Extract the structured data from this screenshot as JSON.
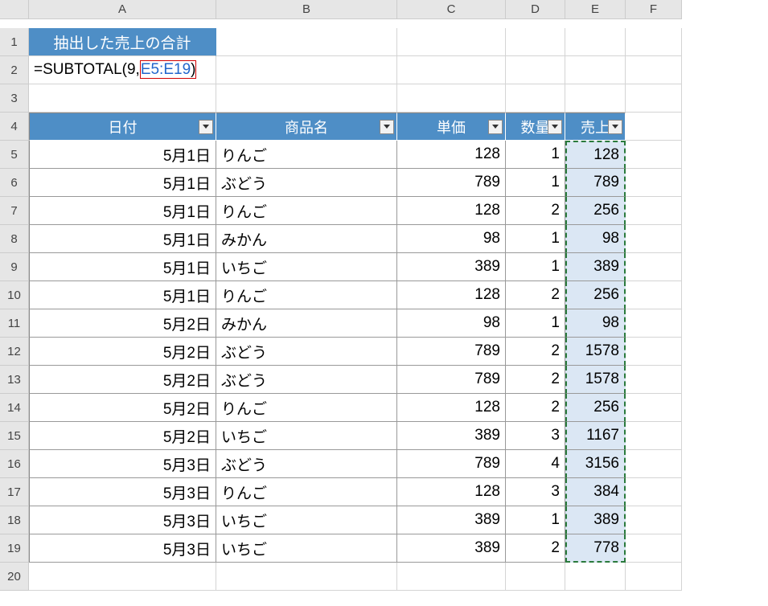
{
  "columns": [
    "A",
    "B",
    "C",
    "D",
    "E",
    "F"
  ],
  "row_numbers": [
    1,
    2,
    3,
    4,
    5,
    6,
    7,
    8,
    9,
    10,
    11,
    12,
    13,
    14,
    15,
    16,
    17,
    18,
    19,
    20
  ],
  "title_cell": "抽出した売上の合計",
  "formula": {
    "prefix": "=SUBTOTAL(9,",
    "ref": "E5:E19",
    "suffix": ")"
  },
  "headers": {
    "date": "日付",
    "product": "商品名",
    "unit_price": "単価",
    "qty": "数量",
    "sales": "売上"
  },
  "rows": [
    {
      "date": "5月1日",
      "product": "りんご",
      "unit_price": 128,
      "qty": 1,
      "sales": 128
    },
    {
      "date": "5月1日",
      "product": "ぶどう",
      "unit_price": 789,
      "qty": 1,
      "sales": 789
    },
    {
      "date": "5月1日",
      "product": "りんご",
      "unit_price": 128,
      "qty": 2,
      "sales": 256
    },
    {
      "date": "5月1日",
      "product": "みかん",
      "unit_price": 98,
      "qty": 1,
      "sales": 98
    },
    {
      "date": "5月1日",
      "product": "いちご",
      "unit_price": 389,
      "qty": 1,
      "sales": 389
    },
    {
      "date": "5月1日",
      "product": "りんご",
      "unit_price": 128,
      "qty": 2,
      "sales": 256
    },
    {
      "date": "5月2日",
      "product": "みかん",
      "unit_price": 98,
      "qty": 1,
      "sales": 98
    },
    {
      "date": "5月2日",
      "product": "ぶどう",
      "unit_price": 789,
      "qty": 2,
      "sales": 1578
    },
    {
      "date": "5月2日",
      "product": "ぶどう",
      "unit_price": 789,
      "qty": 2,
      "sales": 1578
    },
    {
      "date": "5月2日",
      "product": "りんご",
      "unit_price": 128,
      "qty": 2,
      "sales": 256
    },
    {
      "date": "5月2日",
      "product": "いちご",
      "unit_price": 389,
      "qty": 3,
      "sales": 1167
    },
    {
      "date": "5月3日",
      "product": "ぶどう",
      "unit_price": 789,
      "qty": 4,
      "sales": 3156
    },
    {
      "date": "5月3日",
      "product": "りんご",
      "unit_price": 128,
      "qty": 3,
      "sales": 384
    },
    {
      "date": "5月3日",
      "product": "いちご",
      "unit_price": 389,
      "qty": 1,
      "sales": 389
    },
    {
      "date": "5月3日",
      "product": "いちご",
      "unit_price": 389,
      "qty": 2,
      "sales": 778
    }
  ]
}
